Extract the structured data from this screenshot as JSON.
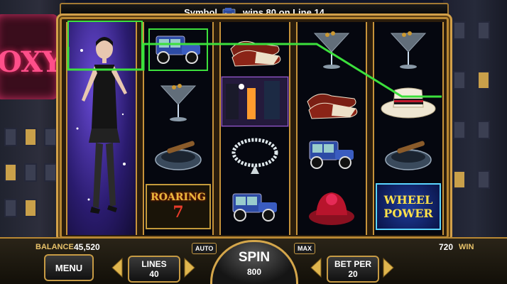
{
  "header": {
    "message_prefix": "Symbol",
    "message_suffix": "wins 80 on Line 14"
  },
  "sign": {
    "text": "OXY'S"
  },
  "reels": [
    {
      "symbols": [
        "flapper-girl-wild"
      ]
    },
    {
      "symbols": [
        "vintage-car",
        "martini-glass",
        "cigar-ashtray",
        "roaring-7"
      ]
    },
    {
      "symbols": [
        "two-tone-shoes",
        "night-street-scene",
        "pearl-necklace",
        "vintage-car"
      ]
    },
    {
      "symbols": [
        "martini-glass",
        "two-tone-shoes",
        "vintage-car",
        "red-hat"
      ]
    },
    {
      "symbols": [
        "martini-glass",
        "straw-boater-hat",
        "cigar-ashtray",
        "wheel-power"
      ]
    }
  ],
  "symbol_text": {
    "roaring_top": "ROARING",
    "roaring_bottom": "7",
    "wheel_top": "WHEEL",
    "wheel_bottom": "POWER"
  },
  "colors": {
    "winline": "#3ce03c",
    "gold": "#c69a44"
  },
  "console": {
    "balance_label": "BALANCE",
    "balance_value": "45,520",
    "win_value": "720",
    "win_label": "WIN",
    "menu_label": "MENU",
    "lines_label": "LINES",
    "lines_value": "40",
    "auto_label": "AUTO",
    "spin_label": "SPIN",
    "spin_value": "800",
    "max_label": "MAX",
    "betper_label": "BET PER",
    "betper_value": "20"
  }
}
